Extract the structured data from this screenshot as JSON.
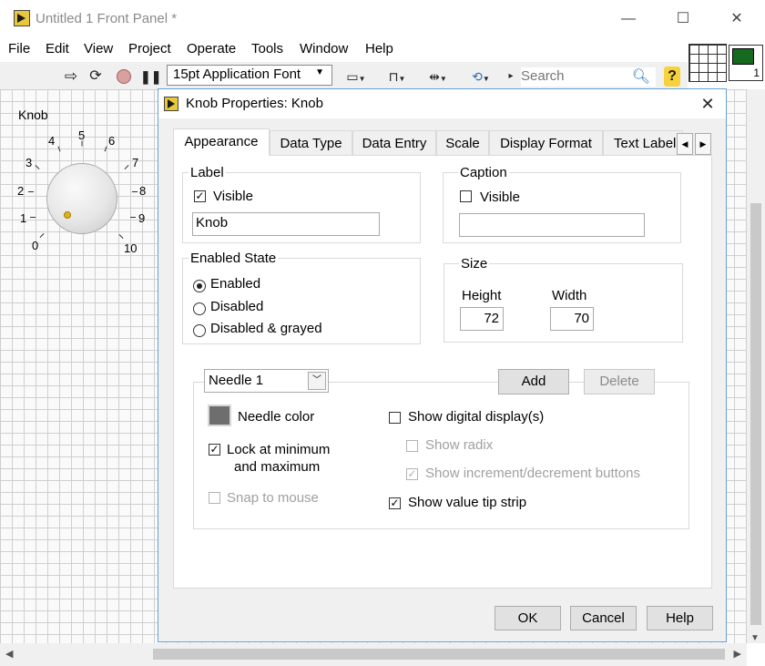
{
  "window": {
    "title": "Untitled 1 Front Panel *",
    "minimize": "—",
    "maximize": "☐",
    "close": "✕"
  },
  "menu": [
    "File",
    "Edit",
    "View",
    "Project",
    "Operate",
    "Tools",
    "Window",
    "Help"
  ],
  "toolbar": {
    "font": "15pt Application Font",
    "search_placeholder": "Search",
    "help_label": "?",
    "vi_icon_number": "1"
  },
  "panel": {
    "knob_label": "Knob",
    "knob_scale": [
      "0",
      "1",
      "2",
      "3",
      "4",
      "5",
      "6",
      "7",
      "8",
      "9",
      "10"
    ]
  },
  "dialog": {
    "title": "Knob Properties: Knob",
    "tabs": [
      "Appearance",
      "Data Type",
      "Data Entry",
      "Scale",
      "Display Format",
      "Text Label"
    ],
    "active_tab": "Appearance",
    "label_group": {
      "title": "Label",
      "visible_label": "Visible",
      "visible_checked": true,
      "value": "Knob"
    },
    "caption_group": {
      "title": "Caption",
      "visible_label": "Visible",
      "visible_checked": false,
      "value": ""
    },
    "enabled_group": {
      "title": "Enabled State",
      "options": [
        "Enabled",
        "Disabled",
        "Disabled & grayed"
      ],
      "selected": "Enabled"
    },
    "size_group": {
      "title": "Size",
      "height_label": "Height",
      "width_label": "Width",
      "height": "72",
      "width": "70"
    },
    "needle": {
      "select": "Needle 1",
      "add": "Add",
      "delete": "Delete",
      "color_label": "Needle color",
      "color": "#6e6e6e",
      "lock_line1": "Lock at minimum",
      "lock_line2": "and maximum",
      "lock_checked": true,
      "snap": "Snap to mouse",
      "snap_checked": false,
      "show_digital": "Show digital display(s)",
      "show_digital_checked": false,
      "show_radix": "Show radix",
      "show_radix_checked": false,
      "show_incdec": "Show increment/decrement buttons",
      "show_incdec_checked": true,
      "show_tip": "Show value tip strip",
      "show_tip_checked": true
    },
    "buttons": {
      "ok": "OK",
      "cancel": "Cancel",
      "help": "Help"
    }
  }
}
